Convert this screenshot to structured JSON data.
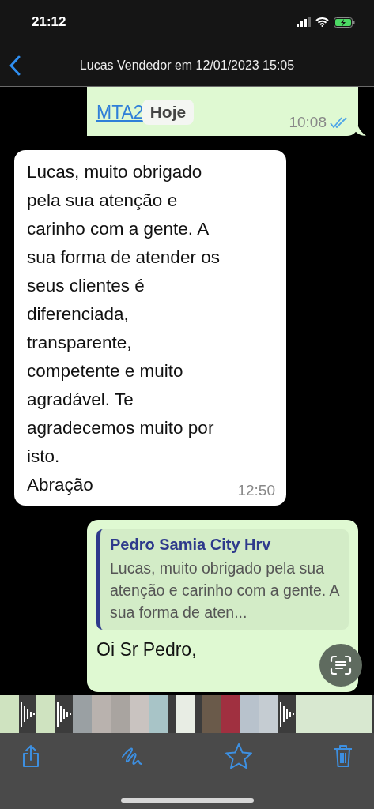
{
  "status_bar": {
    "time": "21:12"
  },
  "nav": {
    "title": "Lucas Vendedor em 12/01/2023 15:05"
  },
  "date_chip": "Hoje",
  "messages": [
    {
      "kind": "sent_link",
      "link": "MTA2",
      "time": "10:08",
      "read": true
    },
    {
      "kind": "received",
      "text": "Lucas, muito obrigado\npela sua atenção e\ncarinho com a gente. A\nsua forma de atender os\nseus clientes é\ndiferenciada,\ntransparente,\ncompetente e muito\nagradável. Te\nagradecemos muito por\nisto.\nAbração",
      "time": "12:50"
    },
    {
      "kind": "sent_reply",
      "quote": {
        "author": "Pedro Samia City Hrv",
        "text": "Lucas, muito obrigado pela sua atenção e carinho com a gente. A sua forma de aten..."
      },
      "text": "Oi Sr Pedro,"
    }
  ]
}
